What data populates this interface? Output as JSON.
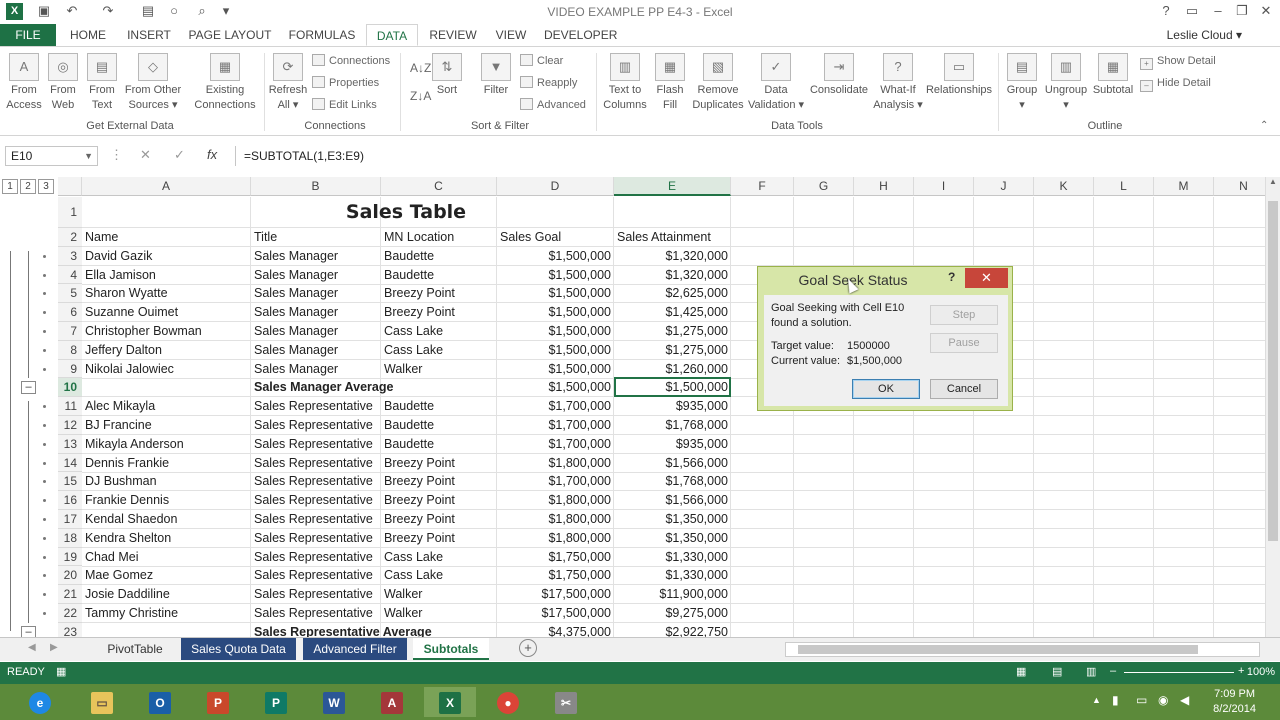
{
  "window": {
    "title": "VIDEO EXAMPLE PP E4-3 - Excel",
    "user": "Leslie Cloud"
  },
  "ribbon": {
    "file_tab": "FILE",
    "tabs": [
      "HOME",
      "INSERT",
      "PAGE LAYOUT",
      "FORMULAS",
      "DATA",
      "REVIEW",
      "VIEW",
      "DEVELOPER"
    ],
    "active_tab": "DATA",
    "groups": {
      "external": {
        "label": "Get External Data",
        "buttons": [
          {
            "l1": "From",
            "l2": "Access"
          },
          {
            "l1": "From",
            "l2": "Web"
          },
          {
            "l1": "From",
            "l2": "Text"
          },
          {
            "l1": "From Other",
            "l2": "Sources ▾"
          },
          {
            "l1": "Existing",
            "l2": "Connections"
          }
        ]
      },
      "connections": {
        "label": "Connections",
        "refresh": {
          "l1": "Refresh",
          "l2": "All ▾"
        },
        "small": [
          "Connections",
          "Properties",
          "Edit Links"
        ]
      },
      "sortfilter": {
        "label": "Sort & Filter",
        "sort": "Sort",
        "filter": "Filter",
        "small": [
          "Clear",
          "Reapply",
          "Advanced"
        ]
      },
      "datatools": {
        "label": "Data Tools",
        "buttons": [
          {
            "l1": "Text to",
            "l2": "Columns"
          },
          {
            "l1": "Flash",
            "l2": "Fill"
          },
          {
            "l1": "Remove",
            "l2": "Duplicates"
          },
          {
            "l1": "Data",
            "l2": "Validation ▾"
          },
          {
            "l1": "Consolidate",
            "l2": ""
          },
          {
            "l1": "What-If",
            "l2": "Analysis ▾"
          },
          {
            "l1": "Relationships",
            "l2": ""
          }
        ]
      },
      "outline": {
        "label": "Outline",
        "buttons": [
          {
            "l1": "Group",
            "l2": "▾"
          },
          {
            "l1": "Ungroup",
            "l2": "▾"
          },
          {
            "l1": "Subtotal",
            "l2": ""
          }
        ],
        "small": [
          "Show Detail",
          "Hide Detail"
        ]
      }
    }
  },
  "formula_bar": {
    "name_box": "E10",
    "formula": "=SUBTOTAL(1,E3:E9)",
    "fx": "fx"
  },
  "outline_levels": [
    "1",
    "2",
    "3"
  ],
  "columns": [
    "A",
    "B",
    "C",
    "D",
    "E",
    "F",
    "G",
    "H",
    "I",
    "J",
    "K",
    "L",
    "M",
    "N"
  ],
  "sheet": {
    "title": "Sales Table",
    "headers": [
      "Name",
      "Title",
      "MN Location",
      "Sales Goal",
      "Sales Attainment"
    ],
    "rows": [
      {
        "n": "3",
        "a": "David Gazik",
        "b": "Sales Manager",
        "c": "Baudette",
        "d": "$1,500,000",
        "e": "$1,320,000"
      },
      {
        "n": "4",
        "a": "Ella Jamison",
        "b": "Sales Manager",
        "c": "Baudette",
        "d": "$1,500,000",
        "e": "$1,320,000"
      },
      {
        "n": "5",
        "a": "Sharon Wyatte",
        "b": "Sales Manager",
        "c": "Breezy Point",
        "d": "$1,500,000",
        "e": "$2,625,000"
      },
      {
        "n": "6",
        "a": "Suzanne Ouimet",
        "b": "Sales Manager",
        "c": "Breezy Point",
        "d": "$1,500,000",
        "e": "$1,425,000"
      },
      {
        "n": "7",
        "a": "Christopher Bowman",
        "b": "Sales Manager",
        "c": "Cass Lake",
        "d": "$1,500,000",
        "e": "$1,275,000"
      },
      {
        "n": "8",
        "a": "Jeffery Dalton",
        "b": "Sales Manager",
        "c": "Cass Lake",
        "d": "$1,500,000",
        "e": "$1,275,000"
      },
      {
        "n": "9",
        "a": "Nikolai Jalowiec",
        "b": "Sales Manager",
        "c": "Walker",
        "d": "$1,500,000",
        "e": "$1,260,000"
      },
      {
        "n": "10",
        "a": "",
        "b": "Sales Manager Average",
        "c": "",
        "d": "$1,500,000",
        "e": "$1,500,000",
        "bold": true
      },
      {
        "n": "11",
        "a": "Alec Mikayla",
        "b": "Sales Representative",
        "c": "Baudette",
        "d": "$1,700,000",
        "e": "$935,000"
      },
      {
        "n": "12",
        "a": "BJ Francine",
        "b": "Sales Representative",
        "c": "Baudette",
        "d": "$1,700,000",
        "e": "$1,768,000"
      },
      {
        "n": "13",
        "a": "Mikayla Anderson",
        "b": "Sales Representative",
        "c": "Baudette",
        "d": "$1,700,000",
        "e": "$935,000"
      },
      {
        "n": "14",
        "a": "Dennis Frankie",
        "b": "Sales Representative",
        "c": "Breezy Point",
        "d": "$1,800,000",
        "e": "$1,566,000"
      },
      {
        "n": "15",
        "a": "DJ Bushman",
        "b": "Sales Representative",
        "c": "Breezy Point",
        "d": "$1,700,000",
        "e": "$1,768,000"
      },
      {
        "n": "16",
        "a": "Frankie Dennis",
        "b": "Sales Representative",
        "c": "Breezy Point",
        "d": "$1,800,000",
        "e": "$1,566,000"
      },
      {
        "n": "17",
        "a": "Kendal Shaedon",
        "b": "Sales Representative",
        "c": "Breezy Point",
        "d": "$1,800,000",
        "e": "$1,350,000"
      },
      {
        "n": "18",
        "a": "Kendra Shelton",
        "b": "Sales Representative",
        "c": "Breezy Point",
        "d": "$1,800,000",
        "e": "$1,350,000"
      },
      {
        "n": "19",
        "a": "Chad Mei",
        "b": "Sales Representative",
        "c": "Cass Lake",
        "d": "$1,750,000",
        "e": "$1,330,000"
      },
      {
        "n": "20",
        "a": "Mae Gomez",
        "b": "Sales Representative",
        "c": "Cass Lake",
        "d": "$1,750,000",
        "e": "$1,330,000"
      },
      {
        "n": "21",
        "a": "Josie Daddiline",
        "b": "Sales Representative",
        "c": "Walker",
        "d": "$17,500,000",
        "e": "$11,900,000"
      },
      {
        "n": "22",
        "a": "Tammy Christine",
        "b": "Sales Representative",
        "c": "Walker",
        "d": "$17,500,000",
        "e": "$9,275,000"
      },
      {
        "n": "23",
        "a": "",
        "b": "Sales Representative Average",
        "c": "",
        "d": "$4,375,000",
        "e": "$2,922,750",
        "bold": true
      }
    ]
  },
  "sheet_tabs": [
    "PivotTable",
    "Sales Quota Data",
    "Advanced Filter",
    "Subtotals"
  ],
  "active_sheet": "Subtotals",
  "status": {
    "ready": "READY",
    "zoom": "100%"
  },
  "dialog": {
    "title": "Goal Seek Status",
    "help": "?",
    "close": "✕",
    "message_line1": "Goal Seeking with Cell E10",
    "message_line2": "found a solution.",
    "target_label": "Target value:",
    "target_value": "1500000",
    "current_label": "Current value:",
    "current_value": "$1,500,000",
    "step": "Step",
    "pause": "Pause",
    "ok": "OK",
    "cancel": "Cancel"
  },
  "taskbar": {
    "time": "7:09 PM",
    "date": "8/2/2014"
  },
  "colors": {
    "excel_green": "#217346",
    "dialog_frame": "#d7e6a8",
    "colored_sheet_tab": "#2b4a7f"
  }
}
